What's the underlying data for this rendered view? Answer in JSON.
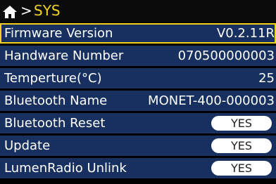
{
  "header": {
    "home_icon": "home-icon",
    "separator": ">",
    "title": "SYS",
    "title_color": "#f2d21e"
  },
  "rows": [
    {
      "label": "Firmware Version",
      "value": "V0.2.11R"
    },
    {
      "label": "Handware Number",
      "value": "070500000003"
    },
    {
      "label": "Temperture(°C)",
      "value": "25"
    },
    {
      "label": "Bluetooth Name",
      "value": "MONET-400-000003"
    },
    {
      "label": "Bluetooth Reset",
      "button": "YES"
    },
    {
      "label": "Update",
      "button": "YES"
    },
    {
      "label": "LumenRadio Unlink",
      "button": "YES"
    }
  ],
  "colors": {
    "row_background": "#17305f",
    "selection_border": "#f2d21e",
    "page_background": "#000000"
  }
}
